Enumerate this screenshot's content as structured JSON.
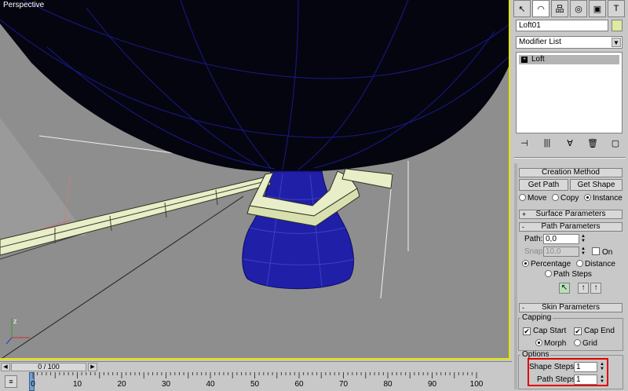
{
  "viewport": {
    "label": "Perspective"
  },
  "panel": {
    "tabs": [
      "create-icon",
      "modify-icon",
      "hierarchy-icon",
      "motion-icon",
      "display-icon",
      "utilities-icon"
    ],
    "tab_glyphs": [
      "↖",
      "◠",
      "品",
      "◎",
      "▣",
      "T"
    ],
    "object_name": "Loft01",
    "modifier_list": "Modifier List",
    "stack_item": "Loft",
    "stack_tools": [
      "⊣",
      "|||",
      "∀",
      "🗑",
      "▢"
    ],
    "creation": {
      "title": "Creation Method",
      "get_path": "Get Path",
      "get_shape": "Get Shape",
      "move": "Move",
      "copy": "Copy",
      "instance": "Instance"
    },
    "surface": {
      "title": "Surface Parameters",
      "sign": "+"
    },
    "path_params": {
      "title": "Path Parameters",
      "sign": "-",
      "path_label": "Path:",
      "path_value": "0,0",
      "snap_label": "Snap:",
      "snap_value": "10,0",
      "on_label": "On",
      "percentage": "Percentage",
      "distance": "Distance",
      "path_steps": "Path Steps"
    },
    "skin": {
      "title": "Skin Parameters",
      "sign": "-",
      "capping": "Capping",
      "cap_start": "Cap Start",
      "cap_end": "Cap End",
      "morph": "Morph",
      "grid": "Grid",
      "options": "Options",
      "shape_steps_label": "Shape Steps:",
      "shape_steps_value": "1",
      "path_steps_label": "Path Steps:",
      "path_steps_value": "1"
    }
  },
  "timeline": {
    "frame_display": "0 / 100",
    "ticks": [
      "0",
      "10",
      "20",
      "30",
      "40",
      "50",
      "60",
      "70",
      "80",
      "90",
      "100"
    ]
  }
}
